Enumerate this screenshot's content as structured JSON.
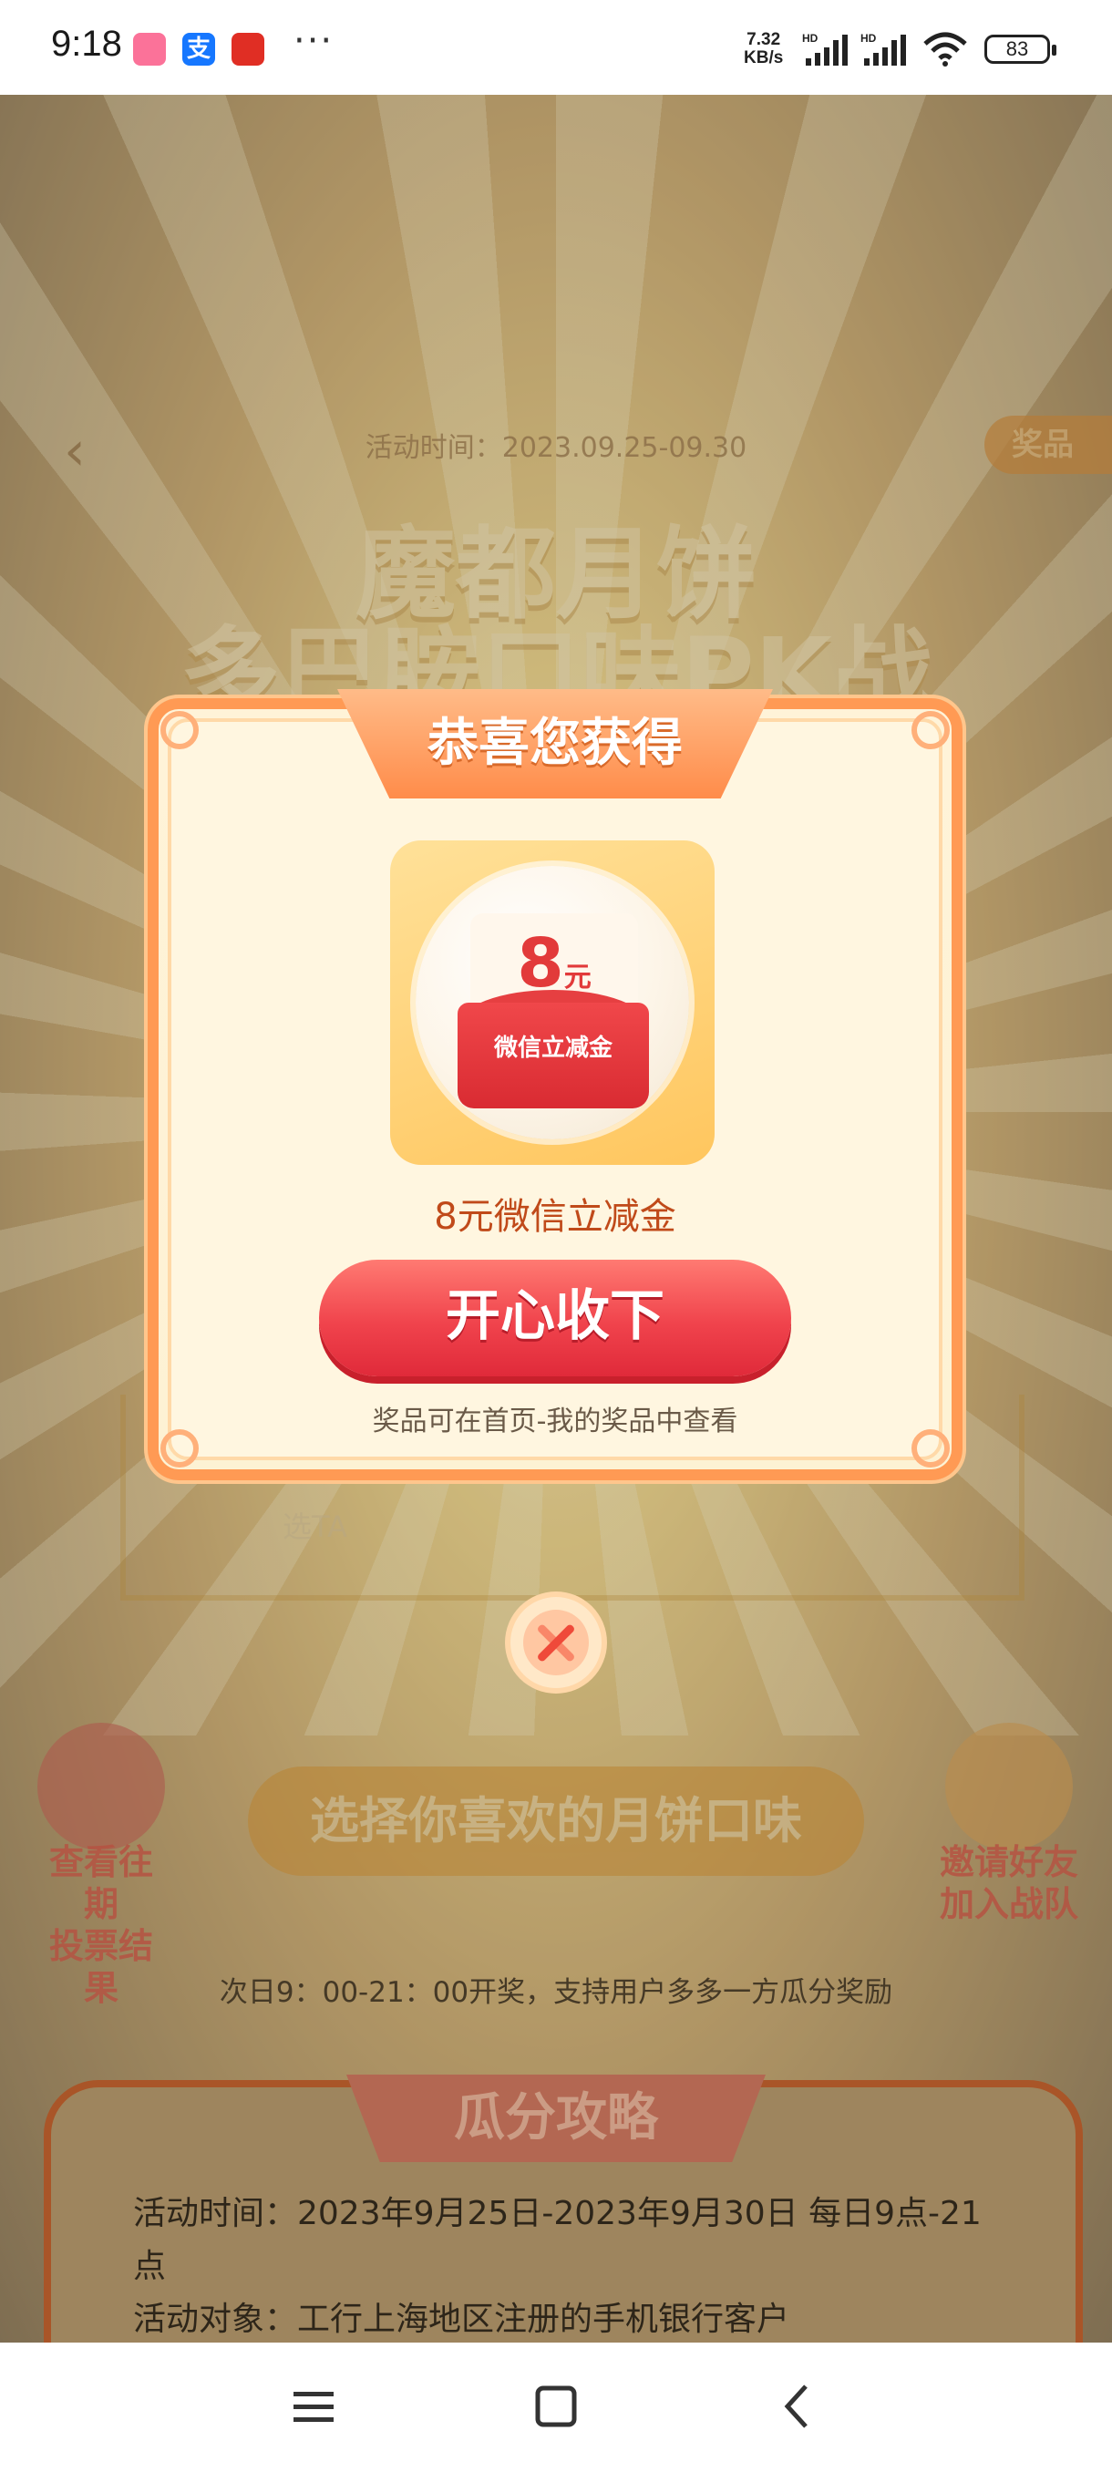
{
  "status_bar": {
    "time": "9:18",
    "net_speed_line1": "7.32",
    "net_speed_line2": "KB/s",
    "battery": "83",
    "more": "···"
  },
  "background": {
    "activity_time": "活动时间：2023.09.25-09.30",
    "prize_tab": "奖品",
    "title_line1": "魔都月饼",
    "title_line2": "多巴胺口味PK战",
    "vote_left": "选TA",
    "history_label_line1": "查看往期",
    "history_label_line2": "投票结果",
    "select_button": "选择你喜欢的月饼口味",
    "invite_label_line1": "邀请好友",
    "invite_label_line2": "加入战队",
    "note": "次日9：00-21：00开奖，支持用户多多一方瓜分奖励",
    "strategy_title": "瓜分攻略",
    "strategy_line1": "活动时间：2023年9月25日-2023年9月30日 每日9点-21点",
    "strategy_line2": "活动对象：工行上海地区注册的手机银行客户"
  },
  "modal": {
    "header": "恭喜您获得",
    "amount": "8",
    "amount_unit": "元",
    "envelope_label": "微信立减金",
    "prize_name": "8元微信立减金",
    "accept_button": "开心收下",
    "hint": "奖品可在首页-我的奖品中查看"
  },
  "colors": {
    "accent_red": "#e23a3a",
    "modal_border": "#ff9a54",
    "button_red": "#f0434c"
  }
}
